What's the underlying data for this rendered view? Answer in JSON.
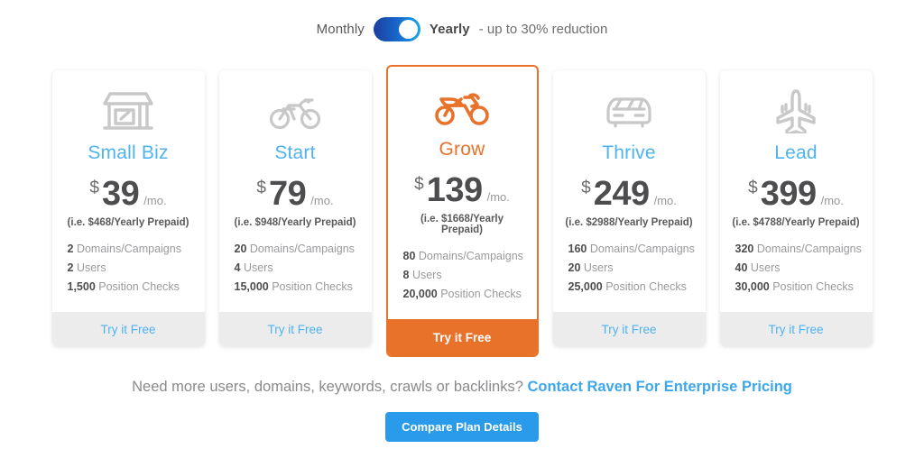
{
  "billing_toggle": {
    "monthly_label": "Monthly",
    "yearly_label": "Yearly",
    "reduction_note": "- up to 30% reduction",
    "selected": "Yearly",
    "switch_icon": "toggle-switch-on-icon"
  },
  "colors": {
    "accent_blue": "#4fb3f0",
    "accent_orange": "#e8722a",
    "button_blue": "#2a9bea",
    "icon_gray": "#c8c8c8",
    "footer_gray": "#ececec"
  },
  "plans": [
    {
      "id": "small-biz",
      "name": "Small Biz",
      "icon": "storefront-icon",
      "currency": "$",
      "amount": "39",
      "per": "/mo.",
      "prepaid": "(i.e. $468/Yearly Prepaid)",
      "features": [
        {
          "value": "2",
          "label": "Domains/Campaigns"
        },
        {
          "value": "2",
          "label": "Users"
        },
        {
          "value": "1,500",
          "label": "Position Checks"
        }
      ],
      "cta": "Try it Free",
      "featured": false
    },
    {
      "id": "start",
      "name": "Start",
      "icon": "bicycle-icon",
      "currency": "$",
      "amount": "79",
      "per": "/mo.",
      "prepaid": "(i.e. $948/Yearly Prepaid)",
      "features": [
        {
          "value": "20",
          "label": "Domains/Campaigns"
        },
        {
          "value": "4",
          "label": "Users"
        },
        {
          "value": "15,000",
          "label": "Position Checks"
        }
      ],
      "cta": "Try it Free",
      "featured": false
    },
    {
      "id": "grow",
      "name": "Grow",
      "icon": "motorcycle-icon",
      "currency": "$",
      "amount": "139",
      "per": "/mo.",
      "prepaid": "(i.e. $1668/Yearly Prepaid)",
      "features": [
        {
          "value": "80",
          "label": "Domains/Campaigns"
        },
        {
          "value": "8",
          "label": "Users"
        },
        {
          "value": "20,000",
          "label": "Position Checks"
        }
      ],
      "cta": "Try it Free",
      "featured": true
    },
    {
      "id": "thrive",
      "name": "Thrive",
      "icon": "car-icon",
      "currency": "$",
      "amount": "249",
      "per": "/mo.",
      "prepaid": "(i.e. $2988/Yearly Prepaid)",
      "features": [
        {
          "value": "160",
          "label": "Domains/Campaigns"
        },
        {
          "value": "20",
          "label": "Users"
        },
        {
          "value": "25,000",
          "label": "Position Checks"
        }
      ],
      "cta": "Try it Free",
      "featured": false
    },
    {
      "id": "lead",
      "name": "Lead",
      "icon": "airplane-icon",
      "currency": "$",
      "amount": "399",
      "per": "/mo.",
      "prepaid": "(i.e. $4788/Yearly Prepaid)",
      "features": [
        {
          "value": "320",
          "label": "Domains/Campaigns"
        },
        {
          "value": "40",
          "label": "Users"
        },
        {
          "value": "30,000",
          "label": "Position Checks"
        }
      ],
      "cta": "Try it Free",
      "featured": false
    }
  ],
  "footer": {
    "need_more_text": "Need more users, domains, keywords, crawls or backlinks?",
    "enterprise_link": "Contact Raven For Enterprise Pricing",
    "compare_button": "Compare Plan Details"
  }
}
